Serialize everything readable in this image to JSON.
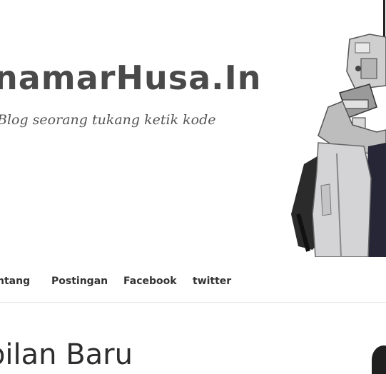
{
  "header": {
    "title": "namarHusa.In",
    "description": "Blog seorang tukang ketik kode"
  },
  "nav": {
    "items": [
      {
        "label": "ntang"
      },
      {
        "label": "Postingan"
      },
      {
        "label": "Facebook"
      },
      {
        "label": "twitter"
      }
    ]
  },
  "main": {
    "post_title": "pilan Baru"
  }
}
